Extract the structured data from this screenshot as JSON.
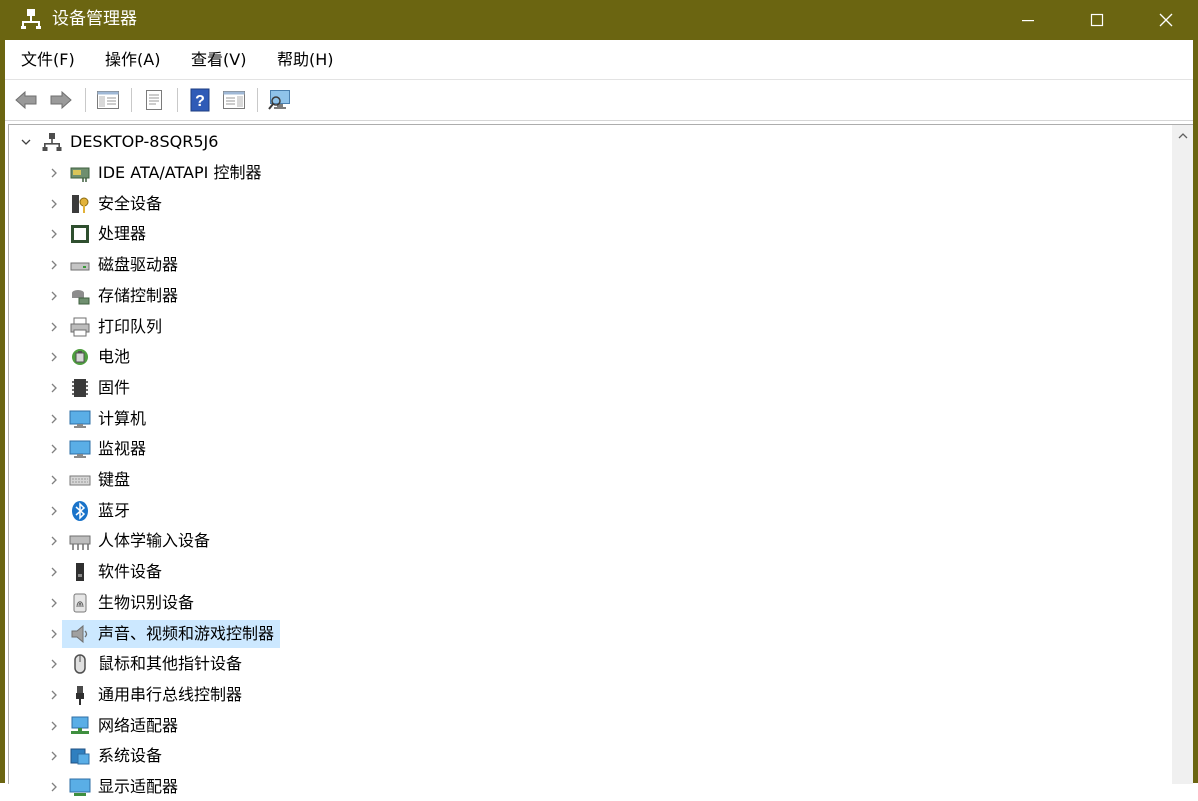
{
  "window": {
    "title": "设备管理器"
  },
  "menu": [
    {
      "label": "文件(F)"
    },
    {
      "label": "操作(A)"
    },
    {
      "label": "查看(V)"
    },
    {
      "label": "帮助(H)"
    }
  ],
  "tree": {
    "root": "DESKTOP-8SQR5J6",
    "items": [
      {
        "label": "IDE ATA/ATAPI 控制器",
        "icon": "ide-controller-icon"
      },
      {
        "label": "安全设备",
        "icon": "security-device-icon"
      },
      {
        "label": "处理器",
        "icon": "processor-icon"
      },
      {
        "label": "磁盘驱动器",
        "icon": "disk-drive-icon"
      },
      {
        "label": "存储控制器",
        "icon": "storage-controller-icon"
      },
      {
        "label": "打印队列",
        "icon": "print-queue-icon"
      },
      {
        "label": "电池",
        "icon": "battery-icon"
      },
      {
        "label": "固件",
        "icon": "firmware-icon"
      },
      {
        "label": "计算机",
        "icon": "computer-icon"
      },
      {
        "label": "监视器",
        "icon": "monitor-icon"
      },
      {
        "label": "键盘",
        "icon": "keyboard-icon"
      },
      {
        "label": "蓝牙",
        "icon": "bluetooth-icon"
      },
      {
        "label": "人体学输入设备",
        "icon": "hid-icon"
      },
      {
        "label": "软件设备",
        "icon": "software-device-icon"
      },
      {
        "label": "生物识别设备",
        "icon": "biometric-icon"
      },
      {
        "label": "声音、视频和游戏控制器",
        "icon": "sound-icon",
        "selected": true
      },
      {
        "label": "鼠标和其他指针设备",
        "icon": "mouse-icon"
      },
      {
        "label": "通用串行总线控制器",
        "icon": "usb-icon"
      },
      {
        "label": "网络适配器",
        "icon": "network-adapter-icon"
      },
      {
        "label": "系统设备",
        "icon": "system-device-icon"
      },
      {
        "label": "显示适配器",
        "icon": "display-adapter-icon"
      }
    ]
  }
}
